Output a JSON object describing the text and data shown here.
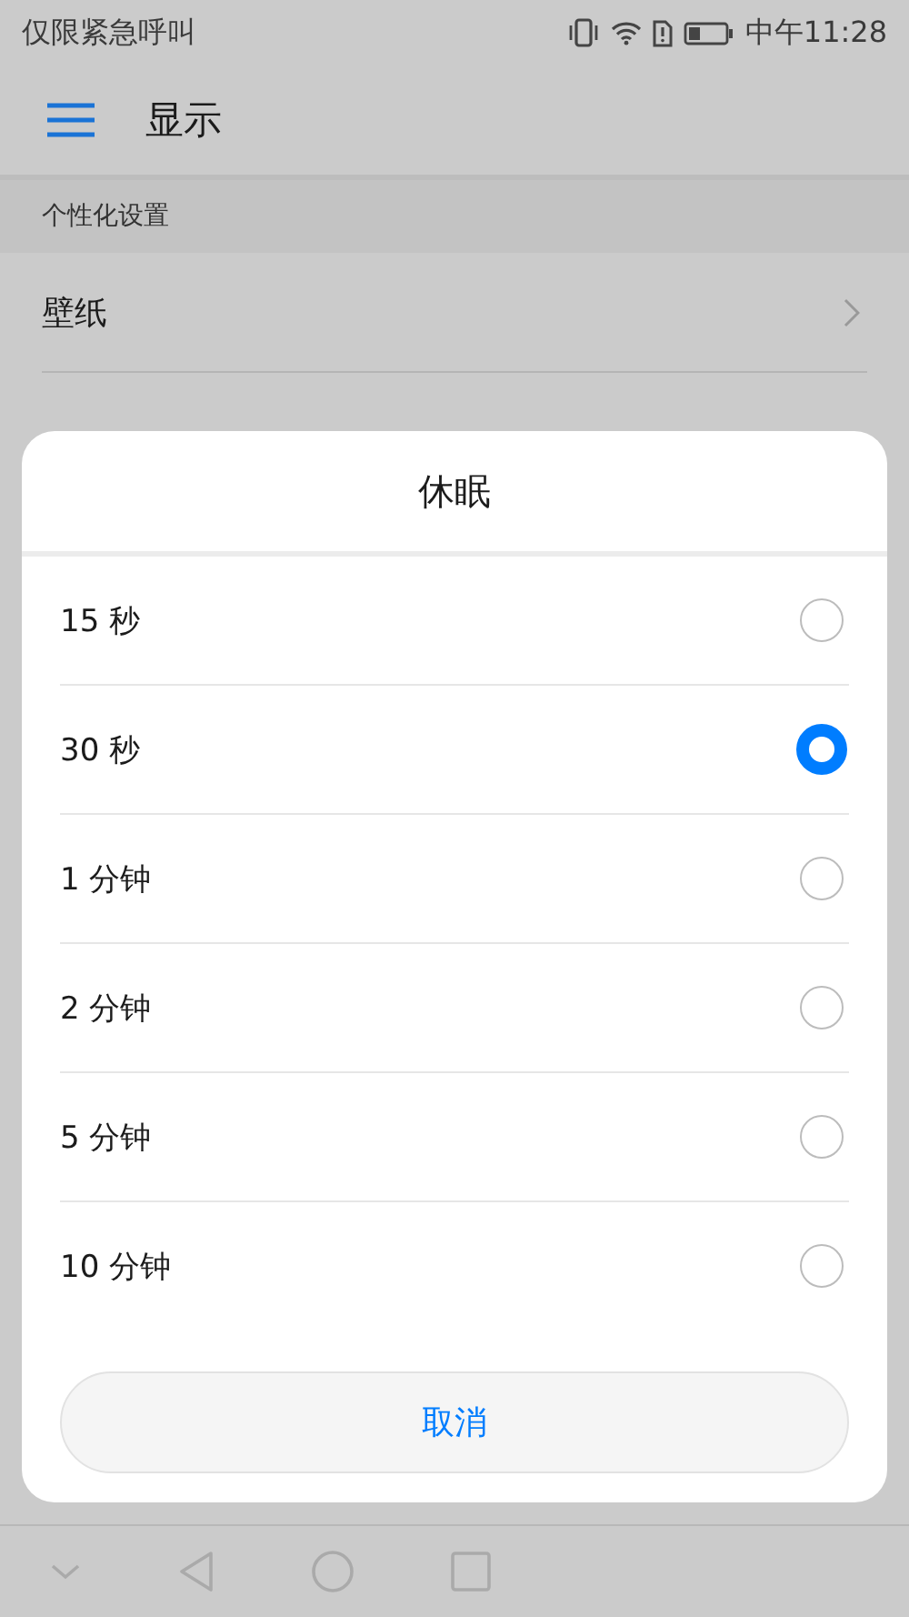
{
  "status_bar": {
    "carrier": "仅限紧急呼叫",
    "time": "中午11:28"
  },
  "header": {
    "title": "显示"
  },
  "settings": {
    "section": "个性化设置",
    "items": [
      {
        "label": "壁纸"
      }
    ]
  },
  "dialog": {
    "title": "休眠",
    "options": [
      {
        "label": "15 秒",
        "selected": false
      },
      {
        "label": "30 秒",
        "selected": true
      },
      {
        "label": "1 分钟",
        "selected": false
      },
      {
        "label": "2 分钟",
        "selected": false
      },
      {
        "label": "5 分钟",
        "selected": false
      },
      {
        "label": "10 分钟",
        "selected": false
      }
    ],
    "cancel": "取消"
  }
}
